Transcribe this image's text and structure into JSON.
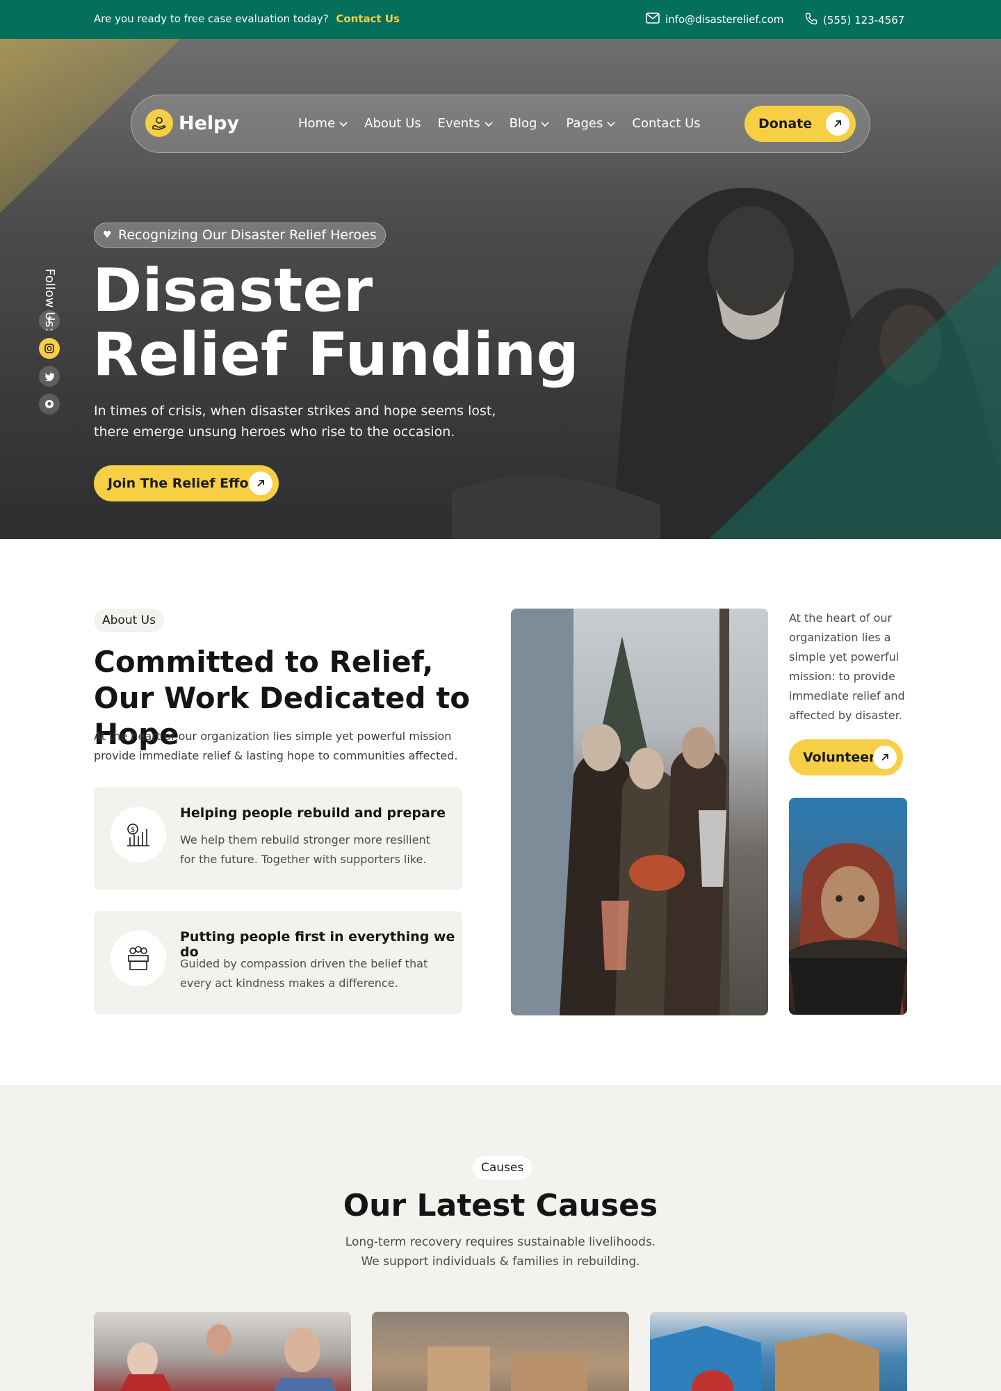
{
  "topbar": {
    "promo_text": "Are you ready to free case evaluation today?",
    "promo_link": "Contact Us",
    "email": "info@disasterelief.com",
    "phone": "(555) 123-4567",
    "bg_color": "#04705c",
    "link_color": "#f7cf45"
  },
  "nav": {
    "logo_text": "Helpy",
    "items": [
      {
        "label": "Home",
        "has_dropdown": true
      },
      {
        "label": "About Us",
        "has_dropdown": false
      },
      {
        "label": "Events",
        "has_dropdown": true
      },
      {
        "label": "Blog",
        "has_dropdown": true
      },
      {
        "label": "Pages",
        "has_dropdown": true
      },
      {
        "label": "Contact Us",
        "has_dropdown": false
      }
    ],
    "donate_label": "Donate"
  },
  "hero": {
    "follow_label": "Follow Us:",
    "social": [
      "facebook-icon",
      "instagram-icon",
      "twitter-icon",
      "github-icon"
    ],
    "badge": "Recognizing Our Disaster Relief Heroes",
    "title": "Disaster Relief Funding",
    "subtitle": "In times of crisis, when disaster strikes and hope seems lost, there emerge unsung heroes who rise to the occasion.",
    "cta": "Join The Relief Effort"
  },
  "about": {
    "tag": "About Us",
    "title": "Committed to Relief, Our Work Dedicated to Hope",
    "subtitle": "At the heart of our organization lies simple yet powerful mission provide immediate relief & lasting hope to communities affected.",
    "features": [
      {
        "title": "Helping people rebuild and prepare",
        "desc": "We help them rebuild stronger more resilient for the future. Together with supporters like."
      },
      {
        "title": "Putting people first in everything we do",
        "desc": "Guided by compassion driven the belief that every act  kindness makes a difference."
      }
    ],
    "side_text": "At the heart of our organization lies a simple yet powerful mission: to provide immediate relief and affected by disaster.",
    "volunteer": "Volunteer"
  },
  "causes": {
    "tag": "Causes",
    "title": "Our Latest Causes",
    "subtitle_1": "Long-term recovery requires sustainable livelihoods.",
    "subtitle_2": "We support individuals & families in rebuilding."
  },
  "colors": {
    "accent": "#f7cf45",
    "brand_green": "#04705c",
    "light_bg": "#f4f2ee"
  }
}
